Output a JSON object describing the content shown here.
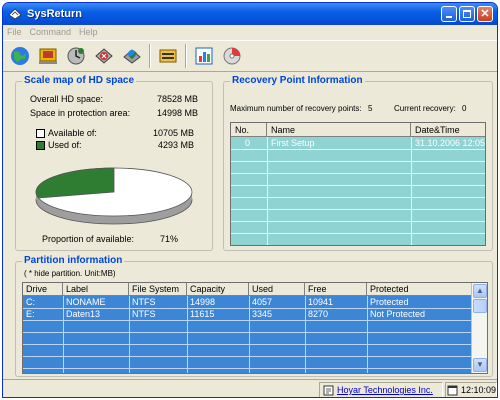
{
  "window": {
    "title": "SysReturn"
  },
  "menu": [
    "File",
    "Command",
    "Help"
  ],
  "toolbar": {
    "icons": [
      "globe-icon",
      "recovery-point-icon",
      "restore-icon",
      "delete-icon",
      "install-icon",
      "drive-icon",
      "chart-report-icon",
      "cd-icon"
    ]
  },
  "scale_map": {
    "title": "Scale map of HD space",
    "overall_label": "Overall HD space:",
    "overall_value": "78528 MB",
    "protection_label": "Space in protection area:",
    "protection_value": "14998 MB",
    "available_label": "Available of:",
    "available_value": "10705 MB",
    "used_label": "Used of:",
    "used_value": "4293 MB",
    "proportion_label": "Proportion of available:",
    "proportion_value": "71%",
    "available_fraction": 0.71,
    "colors": {
      "available": "#ffffff",
      "used": "#2e7d32"
    }
  },
  "recovery": {
    "title": "Recovery Point Information",
    "max_label": "Maximum number of recovery points:",
    "max_value": "5",
    "current_label": "Current recovery:",
    "current_value": "0",
    "columns": [
      "No.",
      "Name",
      "Date&Time"
    ],
    "rows": [
      {
        "no": "0",
        "name": "First Setup",
        "datetime": "31.10.2006 12:05"
      }
    ]
  },
  "partitions": {
    "title": "Partition information",
    "note": "( * hide partition.   Unit:MB)",
    "columns": [
      "Drive",
      "Label",
      "File System",
      "Capacity",
      "Used",
      "Free",
      "Protected"
    ],
    "rows": [
      [
        "C:",
        "NONAME",
        "NTFS",
        "14998",
        "4057",
        "10941",
        "Protected"
      ],
      [
        "E:",
        "Daten13",
        "NTFS",
        "11615",
        "3345",
        "8270",
        "Not Protected"
      ]
    ]
  },
  "status": {
    "link": "Hoyar Technologies Inc.",
    "clock": "12:10:09"
  }
}
